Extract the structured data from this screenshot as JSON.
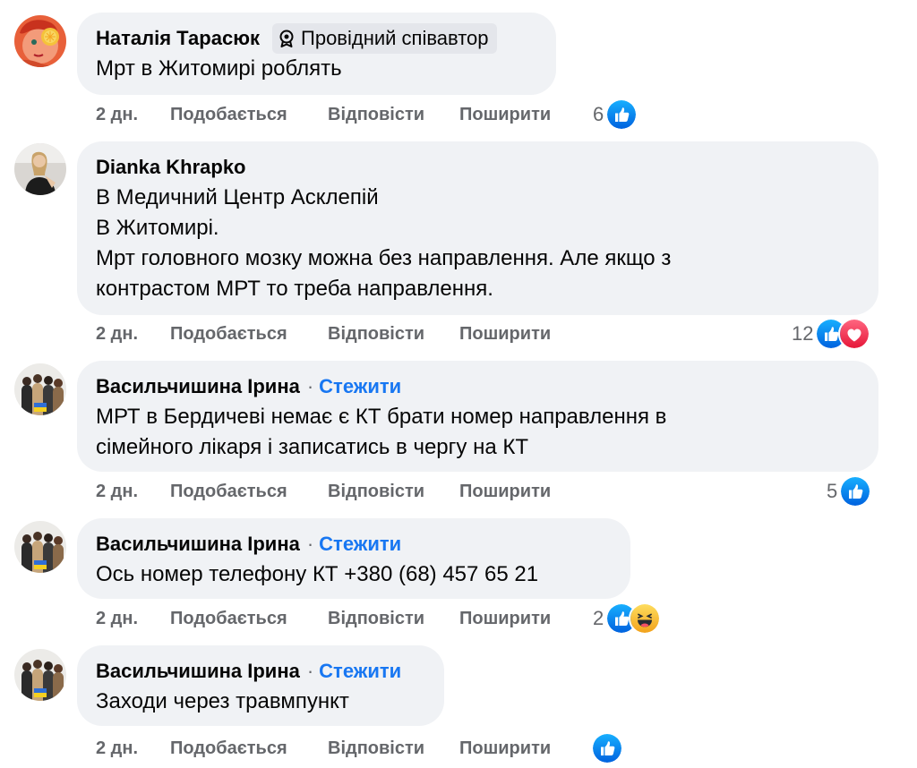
{
  "comments": [
    {
      "author": "Наталія Тарасюк",
      "badge": "Провідний співавтор",
      "text": "Мрт в Житомирі роблять",
      "time": "2 дн.",
      "like": "Подобається",
      "reply": "Відповісти",
      "share": "Поширити",
      "reaction_count": "6",
      "reactions": [
        "like-icon"
      ]
    },
    {
      "author": "Dianka Khrapko",
      "text": "В Медичний Центр Асклепій\nВ Житомирі.\nМрт головного мозку можна без направлення. Але якщо з\nконтрастом МРТ то треба направлення.",
      "time": "2 дн.",
      "like": "Подобається",
      "reply": "Відповісти",
      "share": "Поширити",
      "reaction_count": "12",
      "reactions": [
        "like-icon",
        "love-icon"
      ]
    },
    {
      "author": "Васильчишина Ірина",
      "separator": "·",
      "follow": "Стежити",
      "text": "МРТ в Бердичеві немає є КТ брати номер направлення в\nсімейного лікаря і записатись в чергу на КТ",
      "time": "2 дн.",
      "like": "Подобається",
      "reply": "Відповісти",
      "share": "Поширити",
      "reaction_count": "5",
      "reactions": [
        "like-icon"
      ]
    },
    {
      "author": "Васильчишина Ірина",
      "separator": "·",
      "follow": "Стежити",
      "text": "Ось номер телефону КТ +380 (68) 457 65 21",
      "time": "2 дн.",
      "like": "Подобається",
      "reply": "Відповісти",
      "share": "Поширити",
      "reaction_count": "2",
      "reactions": [
        "like-icon",
        "laughing-icon"
      ]
    },
    {
      "author": "Васильчишина Ірина",
      "separator": "·",
      "follow": "Стежити",
      "text": "Заходи через травмпункт",
      "time": "2 дн.",
      "like": "Подобається",
      "reply": "Відповісти",
      "share": "Поширити",
      "reaction_count": "",
      "reactions": [
        "like-icon"
      ]
    }
  ],
  "colors": {
    "bubble": "#f0f2f5",
    "secondary_text": "#65676b",
    "link_blue": "#1877f2",
    "like_blue": "#1877f2",
    "love_red": "#f33e58",
    "haha_yellow": "#f7b125"
  }
}
